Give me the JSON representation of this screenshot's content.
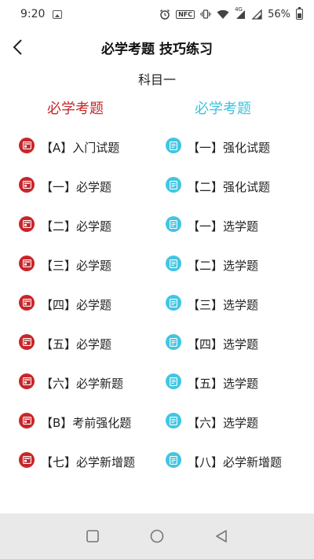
{
  "status_bar": {
    "time": "9:20",
    "battery_text": "56%",
    "network": "4G",
    "nfc": "NFC"
  },
  "header": {
    "title": "必学考题 技巧练习"
  },
  "subject": "科目一",
  "columns": {
    "left": {
      "title": "必学考题",
      "color": "#c8262b",
      "items": [
        {
          "label": "【A】入门试题"
        },
        {
          "label": "【一】必学题"
        },
        {
          "label": "【二】必学题"
        },
        {
          "label": "【三】必学题"
        },
        {
          "label": "【四】必学题"
        },
        {
          "label": "【五】必学题"
        },
        {
          "label": "【六】必学新题"
        },
        {
          "label": "【B】考前强化题"
        },
        {
          "label": "【七】必学新增题"
        }
      ]
    },
    "right": {
      "title": "必学考题",
      "color": "#3ec3de",
      "items": [
        {
          "label": "【一】强化试题"
        },
        {
          "label": "【二】强化试题"
        },
        {
          "label": "【一】选学题"
        },
        {
          "label": "【二】选学题"
        },
        {
          "label": "【三】选学题"
        },
        {
          "label": "【四】选学题"
        },
        {
          "label": "【五】选学题"
        },
        {
          "label": "【六】选学题"
        },
        {
          "label": "【八】必学新增题"
        }
      ]
    }
  }
}
